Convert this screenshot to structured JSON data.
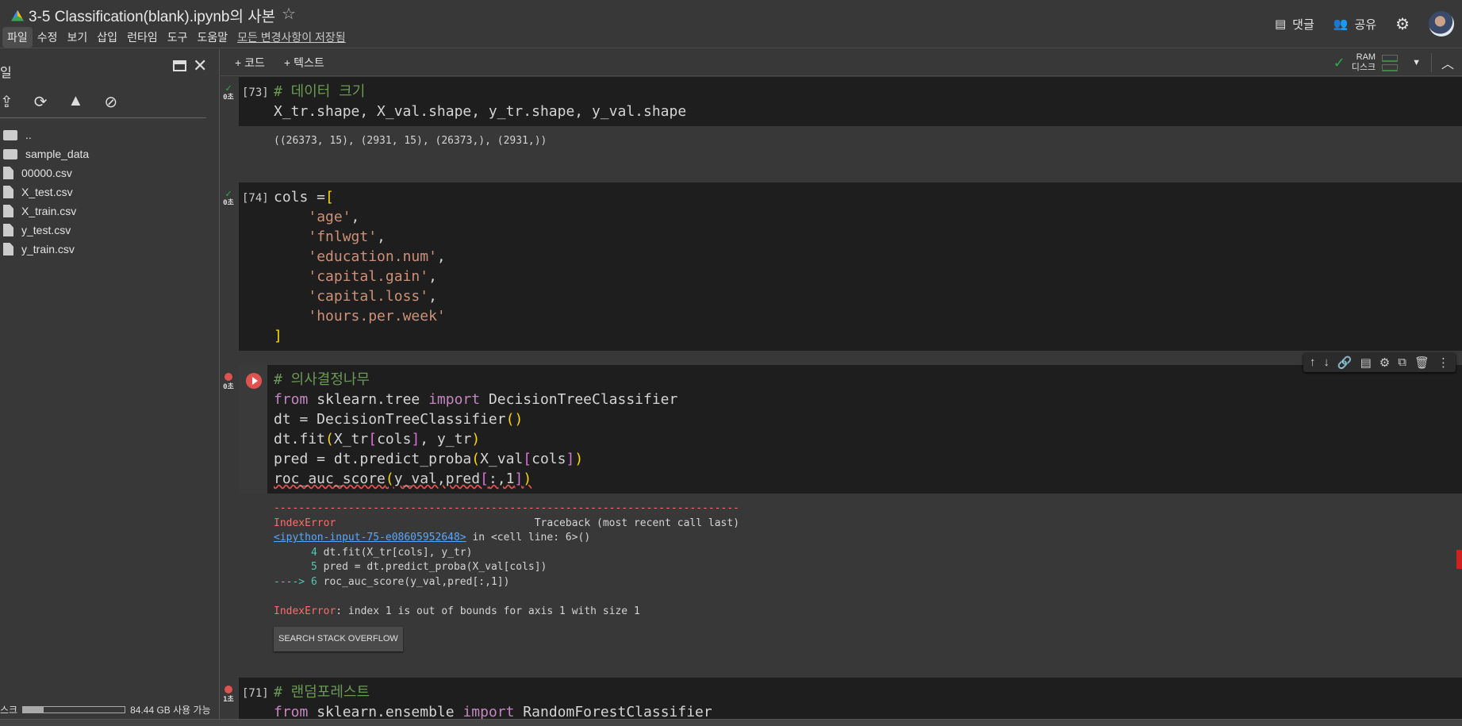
{
  "header": {
    "title": "3-5 Classification(blank).ipynb의 사본",
    "menu": [
      "파일",
      "수정",
      "보기",
      "삽입",
      "런타임",
      "도구",
      "도움말"
    ],
    "saved_status": "모든 변경사항이 저장됨",
    "comment_label": "댓글",
    "share_label": "공유"
  },
  "sidebar": {
    "title": "일",
    "files": [
      {
        "name": "..",
        "type": "parent"
      },
      {
        "name": "sample_data",
        "type": "folder"
      },
      {
        "name": "00000.csv",
        "type": "file"
      },
      {
        "name": "X_test.csv",
        "type": "file"
      },
      {
        "name": "X_train.csv",
        "type": "file"
      },
      {
        "name": "y_test.csv",
        "type": "file"
      },
      {
        "name": "y_train.csv",
        "type": "file"
      }
    ],
    "disk_label": "스크",
    "disk_available": "84.44 GB 사용 가능",
    "disk_used_fraction": 0.2
  },
  "toolbar": {
    "add_code": "+ 코드",
    "add_text": "+ 텍스트",
    "ram_label": "RAM",
    "disk_label": "디스크"
  },
  "cells": [
    {
      "count": "[73]",
      "status": "ok",
      "time": "0초",
      "code": [
        [
          [
            "# 데이터 크기",
            "c-com"
          ]
        ],
        [
          [
            "X_tr.shape, X_val.shape, y_tr.shape, y_val.shape",
            ""
          ]
        ]
      ],
      "output": [
        [
          [
            "((26373, 15), (2931, 15), (26373,), (2931,))",
            ""
          ]
        ]
      ]
    },
    {
      "count": "[74]",
      "status": "ok",
      "time": "0초",
      "code": [
        [
          [
            "cols =",
            ""
          ],
          [
            "[",
            "c-br"
          ]
        ],
        [
          [
            "    ",
            ""
          ],
          [
            "'age'",
            "c-str"
          ],
          [
            ",",
            ""
          ]
        ],
        [
          [
            "    ",
            ""
          ],
          [
            "'fnlwgt'",
            "c-str"
          ],
          [
            ",",
            ""
          ]
        ],
        [
          [
            "    ",
            ""
          ],
          [
            "'education.num'",
            "c-str"
          ],
          [
            ",",
            ""
          ]
        ],
        [
          [
            "    ",
            ""
          ],
          [
            "'capital.gain'",
            "c-str"
          ],
          [
            ",",
            ""
          ]
        ],
        [
          [
            "    ",
            ""
          ],
          [
            "'capital.loss'",
            "c-str"
          ],
          [
            ",",
            ""
          ]
        ],
        [
          [
            "    ",
            ""
          ],
          [
            "'hours.per.week'",
            "c-str"
          ]
        ],
        [
          [
            "]",
            "c-br"
          ]
        ]
      ]
    },
    {
      "count": "",
      "status": "error",
      "time": "0초",
      "code": [
        [
          [
            "# 의사결정나무",
            "c-com"
          ]
        ],
        [
          [
            "from",
            "c-kw"
          ],
          [
            " sklearn.tree ",
            ""
          ],
          [
            "import",
            "c-kw"
          ],
          [
            " DecisionTreeClassifier",
            ""
          ]
        ],
        [
          [
            "dt = DecisionTreeClassifier",
            ""
          ],
          [
            "()",
            "c-br"
          ]
        ],
        [
          [
            "dt.fit",
            ""
          ],
          [
            "(",
            "c-br"
          ],
          [
            "X_tr",
            ""
          ],
          [
            "[",
            "c-br2"
          ],
          [
            "cols",
            ""
          ],
          [
            "]",
            "c-br2"
          ],
          [
            ", y_tr",
            ""
          ],
          [
            ")",
            "c-br"
          ]
        ],
        [
          [
            "pred = dt.predict_proba",
            ""
          ],
          [
            "(",
            "c-br"
          ],
          [
            "X_val",
            ""
          ],
          [
            "[",
            "c-br2"
          ],
          [
            "cols",
            ""
          ],
          [
            "]",
            "c-br2"
          ],
          [
            ")",
            "c-br"
          ]
        ],
        [
          [
            "roc_auc_score",
            ""
          ],
          [
            "(",
            "c-br"
          ],
          [
            "y_val,pred",
            ""
          ],
          [
            "[",
            "c-br2"
          ],
          [
            ":,1",
            ""
          ],
          [
            "]",
            "c-br2"
          ],
          [
            ")",
            "c-br"
          ]
        ]
      ],
      "output": [
        [
          [
            "---------------------------------------------------------------------------",
            "c-red"
          ]
        ],
        [
          [
            "IndexError",
            "c-red"
          ],
          [
            "                                Traceback (most recent call last)",
            ""
          ]
        ],
        [
          [
            "<ipython-input-75-e08605952648>",
            "c-link"
          ],
          [
            " in <cell line: 6>()",
            ""
          ]
        ],
        [
          [
            "      ",
            ""
          ],
          [
            "4",
            "c-num"
          ],
          [
            " dt.fit(X_tr[cols], y_tr)",
            ""
          ]
        ],
        [
          [
            "      ",
            ""
          ],
          [
            "5",
            "c-num"
          ],
          [
            " pred = dt.predict_proba(X_val[cols])",
            ""
          ]
        ],
        [
          [
            "----> ",
            "c-num"
          ],
          [
            "6",
            "c-num"
          ],
          [
            " roc_auc_score(y_val,pred[:,1])",
            ""
          ]
        ],
        [
          [
            "",
            ""
          ]
        ],
        [
          [
            "IndexError",
            "c-red"
          ],
          [
            ": index 1 is out of bounds for axis 1 with size 1",
            ""
          ]
        ]
      ],
      "so_button": "SEARCH STACK OVERFLOW"
    },
    {
      "count": "[71]",
      "status": "error",
      "time": "1초",
      "code": [
        [
          [
            "# 랜덤포레스트",
            "c-com"
          ]
        ],
        [
          [
            "from",
            "c-kw"
          ],
          [
            " sklearn.ensemble ",
            ""
          ],
          [
            "import",
            "c-kw"
          ],
          [
            " RandomForestClassifier",
            ""
          ]
        ]
      ]
    }
  ]
}
